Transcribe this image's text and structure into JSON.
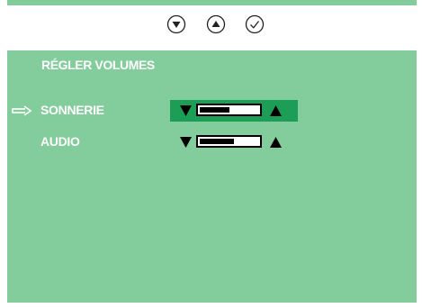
{
  "nav": {
    "buttons": [
      {
        "name": "down-arrow-icon",
        "glyph": "▼"
      },
      {
        "name": "up-arrow-icon",
        "glyph": "▲"
      },
      {
        "name": "checkmark-icon",
        "glyph": "✓"
      }
    ]
  },
  "panel": {
    "title": "RÉGLER VOLUMES",
    "background_color": "#83cc9c",
    "rows": [
      {
        "label": "SONNERIE",
        "selected": true,
        "volume_fraction": 0.5
      },
      {
        "label": "AUDIO",
        "selected": false,
        "volume_fraction": 0.58
      }
    ]
  },
  "colors": {
    "panel": "#83cc9c",
    "selection_highlight": "#1d9e57",
    "text": "#ffffff"
  }
}
